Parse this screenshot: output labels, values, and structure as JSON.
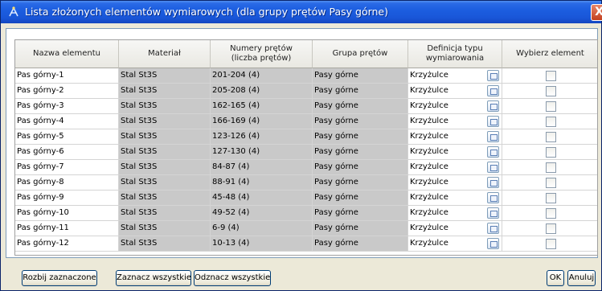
{
  "window": {
    "title": "Lista złożonych elementów wymiarowych (dla grupy prętów Pasy górne)",
    "close_label": "X"
  },
  "table": {
    "columns": [
      {
        "label": "Nazwa elementu"
      },
      {
        "label": "Materiał"
      },
      {
        "label": "Numery prętów\n(liczba prętów)"
      },
      {
        "label": "Grupa prętów"
      },
      {
        "label": "Definicja typu\nwymiarowania"
      },
      {
        "label": "Wybierz element"
      }
    ],
    "rows": [
      {
        "name": "Pas górny-1",
        "material": "Stal St3S",
        "bars": "201-204 (4)",
        "group": "Pasy górne",
        "definition": "Krzyżulce",
        "checked": false
      },
      {
        "name": "Pas górny-2",
        "material": "Stal St3S",
        "bars": "205-208 (4)",
        "group": "Pasy górne",
        "definition": "Krzyżulce",
        "checked": false
      },
      {
        "name": "Pas górny-3",
        "material": "Stal St3S",
        "bars": "162-165 (4)",
        "group": "Pasy górne",
        "definition": "Krzyżulce",
        "checked": false
      },
      {
        "name": "Pas górny-4",
        "material": "Stal St3S",
        "bars": "166-169 (4)",
        "group": "Pasy górne",
        "definition": "Krzyżulce",
        "checked": false
      },
      {
        "name": "Pas górny-5",
        "material": "Stal St3S",
        "bars": "123-126 (4)",
        "group": "Pasy górne",
        "definition": "Krzyżulce",
        "checked": false
      },
      {
        "name": "Pas górny-6",
        "material": "Stal St3S",
        "bars": "127-130 (4)",
        "group": "Pasy górne",
        "definition": "Krzyżulce",
        "checked": false
      },
      {
        "name": "Pas górny-7",
        "material": "Stal St3S",
        "bars": "84-87 (4)",
        "group": "Pasy górne",
        "definition": "Krzyżulce",
        "checked": false
      },
      {
        "name": "Pas górny-8",
        "material": "Stal St3S",
        "bars": "88-91 (4)",
        "group": "Pasy górne",
        "definition": "Krzyżulce",
        "checked": false
      },
      {
        "name": "Pas górny-9",
        "material": "Stal St3S",
        "bars": "45-48 (4)",
        "group": "Pasy górne",
        "definition": "Krzyżulce",
        "checked": false
      },
      {
        "name": "Pas górny-10",
        "material": "Stal St3S",
        "bars": "49-52 (4)",
        "group": "Pasy górne",
        "definition": "Krzyżulce",
        "checked": false
      },
      {
        "name": "Pas górny-11",
        "material": "Stal St3S",
        "bars": "6-9 (4)",
        "group": "Pasy górne",
        "definition": "Krzyżulce",
        "checked": false
      },
      {
        "name": "Pas górny-12",
        "material": "Stal St3S",
        "bars": "10-13 (4)",
        "group": "Pasy górne",
        "definition": "Krzyżulce",
        "checked": false
      }
    ],
    "definition_button_icon": "list-picker-icon"
  },
  "buttons": {
    "split": "Rozbij zaznaczone",
    "select_all": "Zaznacz wszystkie",
    "deselect_all": "Odznacz wszystkie",
    "ok": "OK",
    "cancel": "Anuluj"
  },
  "colors": {
    "title_bar": "#1c5ee0",
    "grey_cell": "#c9c9c9"
  }
}
